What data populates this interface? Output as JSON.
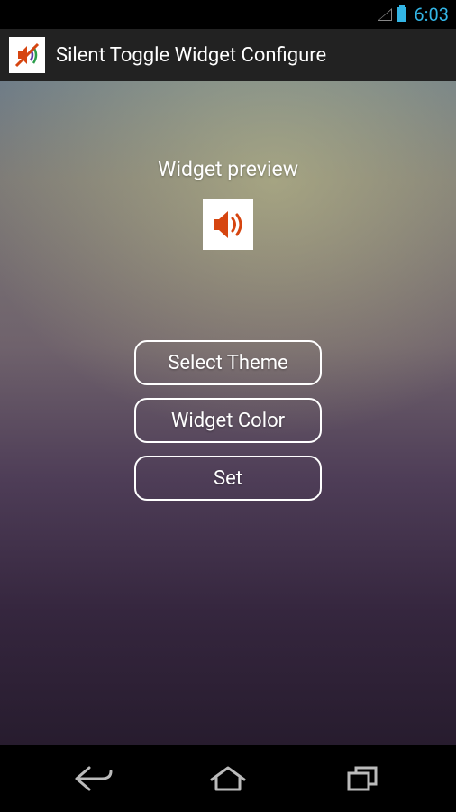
{
  "status": {
    "time": "6:03"
  },
  "actionbar": {
    "title": "Silent Toggle Widget Configure"
  },
  "main": {
    "preview_label": "Widget preview"
  },
  "buttons": {
    "select_theme": "Select Theme",
    "widget_color": "Widget Color",
    "set": "Set"
  }
}
